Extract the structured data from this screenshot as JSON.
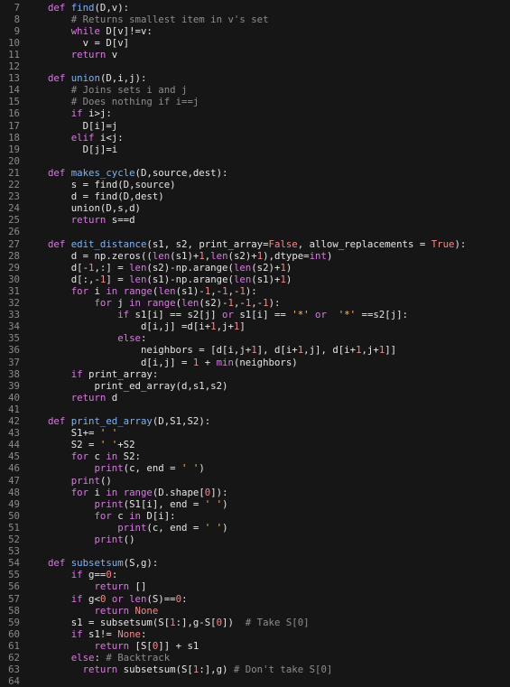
{
  "editor": {
    "theme_colors": {
      "background": "#161616",
      "line_number": "#8b8b8b",
      "text": "#e6e6e6",
      "keyword": "#d97ae3",
      "function": "#7fb4f5",
      "number": "#f28a8a",
      "string": "#f7c173",
      "comment": "#8e8e8e"
    },
    "lines": [
      {
        "n": "7",
        "segs": [
          [
            "kw",
            "def "
          ],
          [
            "fn",
            "find"
          ],
          [
            "op",
            "(D,v):"
          ]
        ]
      },
      {
        "n": "8",
        "segs": [
          [
            "op",
            "    "
          ],
          [
            "com",
            "# Returns smallest item in v's set"
          ]
        ]
      },
      {
        "n": "9",
        "segs": [
          [
            "op",
            "    "
          ],
          [
            "kw",
            "while"
          ],
          [
            "op",
            " D[v]!=v:"
          ]
        ]
      },
      {
        "n": "10",
        "segs": [
          [
            "op",
            "      v = D[v]"
          ]
        ]
      },
      {
        "n": "11",
        "segs": [
          [
            "op",
            "    "
          ],
          [
            "kw",
            "return"
          ],
          [
            "op",
            " v"
          ]
        ]
      },
      {
        "n": "12",
        "segs": [
          [
            "op",
            ""
          ]
        ]
      },
      {
        "n": "13",
        "segs": [
          [
            "kw",
            "def "
          ],
          [
            "fn",
            "union"
          ],
          [
            "op",
            "(D,i,j):"
          ]
        ]
      },
      {
        "n": "14",
        "segs": [
          [
            "op",
            "    "
          ],
          [
            "com",
            "# Joins sets i and j"
          ]
        ]
      },
      {
        "n": "15",
        "segs": [
          [
            "op",
            "    "
          ],
          [
            "com",
            "# Does nothing if i==j"
          ]
        ]
      },
      {
        "n": "16",
        "segs": [
          [
            "op",
            "    "
          ],
          [
            "kw",
            "if"
          ],
          [
            "op",
            " i>j:"
          ]
        ]
      },
      {
        "n": "17",
        "segs": [
          [
            "op",
            "      D[i]=j"
          ]
        ]
      },
      {
        "n": "18",
        "segs": [
          [
            "op",
            "    "
          ],
          [
            "kw",
            "elif"
          ],
          [
            "op",
            " i<j:"
          ]
        ]
      },
      {
        "n": "19",
        "segs": [
          [
            "op",
            "      D[j]=i"
          ]
        ]
      },
      {
        "n": "20",
        "segs": [
          [
            "op",
            ""
          ]
        ]
      },
      {
        "n": "21",
        "segs": [
          [
            "kw",
            "def "
          ],
          [
            "fn",
            "makes_cycle"
          ],
          [
            "op",
            "(D,source,dest):"
          ]
        ]
      },
      {
        "n": "22",
        "segs": [
          [
            "op",
            "    s = find(D,source)"
          ]
        ]
      },
      {
        "n": "23",
        "segs": [
          [
            "op",
            "    d = find(D,dest)"
          ]
        ]
      },
      {
        "n": "24",
        "segs": [
          [
            "op",
            "    union(D,s,d)"
          ]
        ]
      },
      {
        "n": "25",
        "segs": [
          [
            "op",
            "    "
          ],
          [
            "kw",
            "return"
          ],
          [
            "op",
            " s==d"
          ]
        ]
      },
      {
        "n": "26",
        "segs": [
          [
            "op",
            ""
          ]
        ]
      },
      {
        "n": "27",
        "segs": [
          [
            "kw",
            "def "
          ],
          [
            "fn",
            "edit_distance"
          ],
          [
            "op",
            "(s1, s2, print_array="
          ],
          [
            "num",
            "False"
          ],
          [
            "op",
            ", allow_replacements = "
          ],
          [
            "num",
            "True"
          ],
          [
            "op",
            "):"
          ]
        ]
      },
      {
        "n": "28",
        "segs": [
          [
            "op",
            "    d = np.zeros(("
          ],
          [
            "bi",
            "len"
          ],
          [
            "op",
            "(s1)+"
          ],
          [
            "num",
            "1"
          ],
          [
            "op",
            ","
          ],
          [
            "bi",
            "len"
          ],
          [
            "op",
            "(s2)+"
          ],
          [
            "num",
            "1"
          ],
          [
            "op",
            "),dtype="
          ],
          [
            "bi",
            "int"
          ],
          [
            "op",
            ")"
          ]
        ]
      },
      {
        "n": "29",
        "segs": [
          [
            "op",
            "    d[-"
          ],
          [
            "num",
            "1"
          ],
          [
            "op",
            ",:] = "
          ],
          [
            "bi",
            "len"
          ],
          [
            "op",
            "(s2)-np.arange("
          ],
          [
            "bi",
            "len"
          ],
          [
            "op",
            "(s2)+"
          ],
          [
            "num",
            "1"
          ],
          [
            "op",
            ")"
          ]
        ]
      },
      {
        "n": "30",
        "segs": [
          [
            "op",
            "    d[:,-"
          ],
          [
            "num",
            "1"
          ],
          [
            "op",
            "] = "
          ],
          [
            "bi",
            "len"
          ],
          [
            "op",
            "(s1)-np.arange("
          ],
          [
            "bi",
            "len"
          ],
          [
            "op",
            "(s1)+"
          ],
          [
            "num",
            "1"
          ],
          [
            "op",
            ")"
          ]
        ]
      },
      {
        "n": "31",
        "segs": [
          [
            "op",
            "    "
          ],
          [
            "kw",
            "for"
          ],
          [
            "op",
            " i "
          ],
          [
            "kw",
            "in"
          ],
          [
            "op",
            " "
          ],
          [
            "bi",
            "range"
          ],
          [
            "op",
            "("
          ],
          [
            "bi",
            "len"
          ],
          [
            "op",
            "(s1)-"
          ],
          [
            "num",
            "1"
          ],
          [
            "op",
            ",-"
          ],
          [
            "num",
            "1"
          ],
          [
            "op",
            ",-"
          ],
          [
            "num",
            "1"
          ],
          [
            "op",
            "):"
          ]
        ]
      },
      {
        "n": "32",
        "segs": [
          [
            "op",
            "        "
          ],
          [
            "kw",
            "for"
          ],
          [
            "op",
            " j "
          ],
          [
            "kw",
            "in"
          ],
          [
            "op",
            " "
          ],
          [
            "bi",
            "range"
          ],
          [
            "op",
            "("
          ],
          [
            "bi",
            "len"
          ],
          [
            "op",
            "(s2)-"
          ],
          [
            "num",
            "1"
          ],
          [
            "op",
            ",-"
          ],
          [
            "num",
            "1"
          ],
          [
            "op",
            ",-"
          ],
          [
            "num",
            "1"
          ],
          [
            "op",
            "):"
          ]
        ]
      },
      {
        "n": "33",
        "segs": [
          [
            "op",
            "            "
          ],
          [
            "kw",
            "if"
          ],
          [
            "op",
            " s1[i] == s2[j] "
          ],
          [
            "kw",
            "or"
          ],
          [
            "op",
            " s1[i] == "
          ],
          [
            "str",
            "'*'"
          ],
          [
            "op",
            " "
          ],
          [
            "kw",
            "or"
          ],
          [
            "op",
            "  "
          ],
          [
            "str",
            "'*'"
          ],
          [
            "op",
            " ==s2[j]:"
          ]
        ]
      },
      {
        "n": "34",
        "segs": [
          [
            "op",
            "                d[i,j] =d[i+"
          ],
          [
            "num",
            "1"
          ],
          [
            "op",
            ",j+"
          ],
          [
            "num",
            "1"
          ],
          [
            "op",
            "]"
          ]
        ]
      },
      {
        "n": "35",
        "segs": [
          [
            "op",
            "            "
          ],
          [
            "kw",
            "else"
          ],
          [
            "op",
            ":"
          ]
        ]
      },
      {
        "n": "36",
        "segs": [
          [
            "op",
            "                neighbors = [d[i,j+"
          ],
          [
            "num",
            "1"
          ],
          [
            "op",
            "], d[i+"
          ],
          [
            "num",
            "1"
          ],
          [
            "op",
            ",j], d[i+"
          ],
          [
            "num",
            "1"
          ],
          [
            "op",
            ",j+"
          ],
          [
            "num",
            "1"
          ],
          [
            "op",
            "]]"
          ]
        ]
      },
      {
        "n": "37",
        "segs": [
          [
            "op",
            "                d[i,j] = "
          ],
          [
            "num",
            "1"
          ],
          [
            "op",
            " + "
          ],
          [
            "bi",
            "min"
          ],
          [
            "op",
            "(neighbors)"
          ]
        ]
      },
      {
        "n": "38",
        "segs": [
          [
            "op",
            "    "
          ],
          [
            "kw",
            "if"
          ],
          [
            "op",
            " print_array:"
          ]
        ]
      },
      {
        "n": "39",
        "segs": [
          [
            "op",
            "        print_ed_array(d,s1,s2)"
          ]
        ]
      },
      {
        "n": "40",
        "segs": [
          [
            "op",
            "    "
          ],
          [
            "kw",
            "return"
          ],
          [
            "op",
            " d"
          ]
        ]
      },
      {
        "n": "41",
        "segs": [
          [
            "op",
            ""
          ]
        ]
      },
      {
        "n": "42",
        "segs": [
          [
            "kw",
            "def "
          ],
          [
            "fn",
            "print_ed_array"
          ],
          [
            "op",
            "(D,S1,S2):"
          ]
        ]
      },
      {
        "n": "43",
        "segs": [
          [
            "op",
            "    S1+= "
          ],
          [
            "str",
            "' '"
          ]
        ]
      },
      {
        "n": "44",
        "segs": [
          [
            "op",
            "    S2 = "
          ],
          [
            "str",
            "' '"
          ],
          [
            "op",
            "+S2"
          ]
        ]
      },
      {
        "n": "45",
        "segs": [
          [
            "op",
            "    "
          ],
          [
            "kw",
            "for"
          ],
          [
            "op",
            " c "
          ],
          [
            "kw",
            "in"
          ],
          [
            "op",
            " S2:"
          ]
        ]
      },
      {
        "n": "46",
        "segs": [
          [
            "op",
            "        "
          ],
          [
            "bi",
            "print"
          ],
          [
            "op",
            "(c, end = "
          ],
          [
            "str",
            "' '"
          ],
          [
            "op",
            ")"
          ]
        ]
      },
      {
        "n": "47",
        "segs": [
          [
            "op",
            "    "
          ],
          [
            "bi",
            "print"
          ],
          [
            "op",
            "()"
          ]
        ]
      },
      {
        "n": "48",
        "segs": [
          [
            "op",
            "    "
          ],
          [
            "kw",
            "for"
          ],
          [
            "op",
            " i "
          ],
          [
            "kw",
            "in"
          ],
          [
            "op",
            " "
          ],
          [
            "bi",
            "range"
          ],
          [
            "op",
            "(D.shape["
          ],
          [
            "num",
            "0"
          ],
          [
            "op",
            "]):"
          ]
        ]
      },
      {
        "n": "49",
        "segs": [
          [
            "op",
            "        "
          ],
          [
            "bi",
            "print"
          ],
          [
            "op",
            "(S1[i], end = "
          ],
          [
            "str",
            "' '"
          ],
          [
            "op",
            ")"
          ]
        ]
      },
      {
        "n": "50",
        "segs": [
          [
            "op",
            "        "
          ],
          [
            "kw",
            "for"
          ],
          [
            "op",
            " c "
          ],
          [
            "kw",
            "in"
          ],
          [
            "op",
            " D[i]:"
          ]
        ]
      },
      {
        "n": "51",
        "segs": [
          [
            "op",
            "            "
          ],
          [
            "bi",
            "print"
          ],
          [
            "op",
            "(c, end = "
          ],
          [
            "str",
            "' '"
          ],
          [
            "op",
            ")"
          ]
        ]
      },
      {
        "n": "52",
        "segs": [
          [
            "op",
            "        "
          ],
          [
            "bi",
            "print"
          ],
          [
            "op",
            "()"
          ]
        ]
      },
      {
        "n": "53",
        "segs": [
          [
            "op",
            ""
          ]
        ]
      },
      {
        "n": "54",
        "segs": [
          [
            "kw",
            "def "
          ],
          [
            "fn",
            "subsetsum"
          ],
          [
            "op",
            "(S,g):"
          ]
        ]
      },
      {
        "n": "55",
        "segs": [
          [
            "op",
            "    "
          ],
          [
            "kw",
            "if"
          ],
          [
            "op",
            " g=="
          ],
          [
            "num",
            "0"
          ],
          [
            "op",
            ":"
          ]
        ]
      },
      {
        "n": "56",
        "segs": [
          [
            "op",
            "        "
          ],
          [
            "kw",
            "return"
          ],
          [
            "op",
            " []"
          ]
        ]
      },
      {
        "n": "57",
        "segs": [
          [
            "op",
            "    "
          ],
          [
            "kw",
            "if"
          ],
          [
            "op",
            " g<"
          ],
          [
            "num",
            "0"
          ],
          [
            "op",
            " "
          ],
          [
            "kw",
            "or"
          ],
          [
            "op",
            " "
          ],
          [
            "bi",
            "len"
          ],
          [
            "op",
            "(S)=="
          ],
          [
            "num",
            "0"
          ],
          [
            "op",
            ":"
          ]
        ]
      },
      {
        "n": "58",
        "segs": [
          [
            "op",
            "        "
          ],
          [
            "kw",
            "return"
          ],
          [
            "op",
            " "
          ],
          [
            "num",
            "None"
          ]
        ]
      },
      {
        "n": "59",
        "segs": [
          [
            "op",
            "    s1 = subsetsum(S["
          ],
          [
            "num",
            "1"
          ],
          [
            "op",
            ":],g-S["
          ],
          [
            "num",
            "0"
          ],
          [
            "op",
            "])  "
          ],
          [
            "com",
            "# Take S[0]"
          ]
        ]
      },
      {
        "n": "60",
        "segs": [
          [
            "op",
            "    "
          ],
          [
            "kw",
            "if"
          ],
          [
            "op",
            " s1!= "
          ],
          [
            "num",
            "None"
          ],
          [
            "op",
            ":"
          ]
        ]
      },
      {
        "n": "61",
        "segs": [
          [
            "op",
            "        "
          ],
          [
            "kw",
            "return"
          ],
          [
            "op",
            " [S["
          ],
          [
            "num",
            "0"
          ],
          [
            "op",
            "]] + s1"
          ]
        ]
      },
      {
        "n": "62",
        "segs": [
          [
            "op",
            "    "
          ],
          [
            "kw",
            "else"
          ],
          [
            "op",
            ": "
          ],
          [
            "com",
            "# Backtrack"
          ]
        ]
      },
      {
        "n": "63",
        "segs": [
          [
            "op",
            "      "
          ],
          [
            "kw",
            "return"
          ],
          [
            "op",
            " subsetsum(S["
          ],
          [
            "num",
            "1"
          ],
          [
            "op",
            ":],g) "
          ],
          [
            "com",
            "# Don't take S[0]"
          ]
        ]
      },
      {
        "n": "64",
        "segs": [
          [
            "op",
            ""
          ]
        ]
      }
    ]
  }
}
